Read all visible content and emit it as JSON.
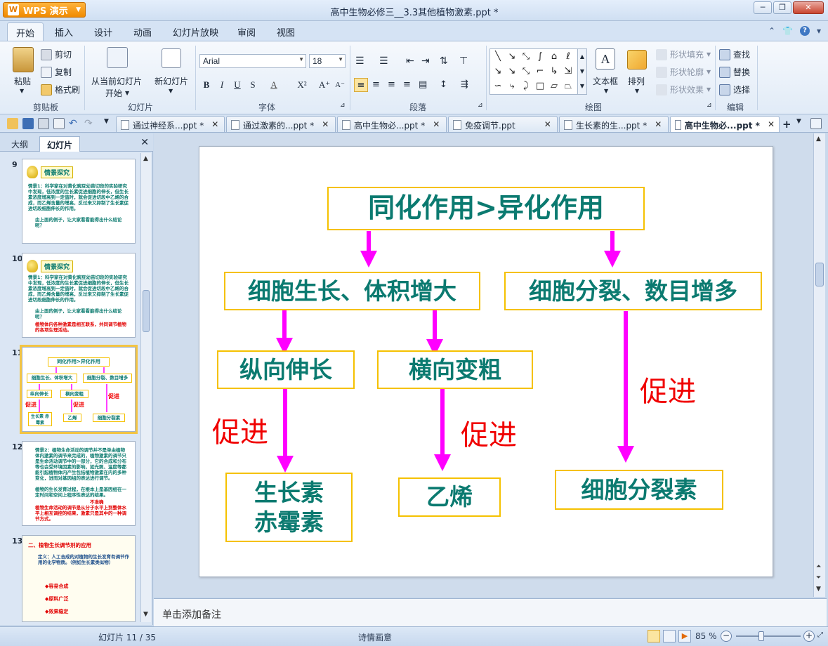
{
  "app": {
    "menu_button": "WPS 演示",
    "window_title": "高中生物必修三__3.3其他植物激素.ppt *"
  },
  "ribbon_tabs": [
    "开始",
    "插入",
    "设计",
    "动画",
    "幻灯片放映",
    "审阅",
    "视图"
  ],
  "ribbon": {
    "clipboard": {
      "paste": "粘贴",
      "cut": "剪切",
      "copy": "复制",
      "format_painter": "格式刷",
      "label": "剪贴板"
    },
    "slides": {
      "from_current": "从当前幻灯片",
      "start": "开始",
      "new_slide": "新幻灯片",
      "label": "幻灯片"
    },
    "font": {
      "family": "Arial",
      "size": "18",
      "label": "字体"
    },
    "paragraph": {
      "label": "段落"
    },
    "drawing": {
      "textbox": "文本框",
      "arrange": "排列",
      "shape_fill": "形状填充",
      "shape_outline": "形状轮廓",
      "shape_effect": "形状效果",
      "label": "绘图"
    },
    "editing": {
      "find": "查找",
      "replace": "替换",
      "select": "选择",
      "label": "编辑"
    }
  },
  "doc_tabs": [
    {
      "label": "通过神经系...ppt *"
    },
    {
      "label": "通过激素的...ppt *"
    },
    {
      "label": "高中生物必...ppt *"
    },
    {
      "label": "免疫调节.ppt"
    },
    {
      "label": "生长素的生...ppt *"
    },
    {
      "label": "高中生物必...ppt *",
      "active": true
    }
  ],
  "left_panel": {
    "tab_outline": "大纲",
    "tab_slides": "幻灯片",
    "thumbnails": [
      {
        "num": "9",
        "heading": "情景探究",
        "text": "情景1：科学家在对黄化豌豆幼苗切段的实验研究中发现，低浓度的生长素促进细胞的伸长，但生长素浓度增高到一定值时，就会促进切段中乙烯的合成，而乙烯含量的增高，反过来又抑制了生长素促进切段细胞伸长的作用。",
        "text2": "由上面的例子，让大家看看能得出什么结论呢？"
      },
      {
        "num": "10",
        "heading": "情景探究",
        "text": "情景1：科学家在对黄化豌豆幼苗切段的实验研究中发现，低浓度的生长素促进细胞的伸长，但生长素浓度增高到一定值时，就会促进切段中乙烯的合成，而乙烯含量的增高，反过来又抑制了生长素促进切段细胞伸长的作用。",
        "text2": "由上面的例子，让大家看看能得出什么结论呢？",
        "red": "植物体内各种激素是相互联系，共同调节植物的各项生理活动。"
      },
      {
        "num": "11"
      },
      {
        "num": "12",
        "text": "情景2：植物生命活动的调节并不是单由植物体内激素的调节来完成的，植物激素的调节只是生命活动调节中的一部分，它的合成和分布等也会受环境因素的影响，如光照、温度等都能引起植物体内产生包括植物激素在内的多种变化，进而对基因组的表达进行调节。",
        "text2": "植物的生长发育过程，在根本上是基因组在一定时间和空间上程序性表达的结果。",
        "red_label": "不准确",
        "red": "植物生命活动的调节是从分子水平上到整体水平上相互调控的结果，激素只是其中的一种调节方式。"
      },
      {
        "num": "13",
        "title": "二、植物生长调节剂的应用",
        "text": "定义：人工合成的对植物的生长发育有调节作用的化学物质。（例如生长素类似物）",
        "bullets": [
          "◆容易合成",
          "◆原料广泛",
          "◆效果稳定"
        ]
      }
    ],
    "mini_slide": {
      "top": "同化作用>异化作用",
      "left": "细胞生长、体积增大",
      "right": "细胞分裂、数目增多",
      "vertical": "纵向伸长",
      "transverse": "横向变粗",
      "auxin": "生长素 赤霉素",
      "ethylene": "乙烯",
      "cytokinin": "细胞分裂素",
      "promote": "促进"
    }
  },
  "slide": {
    "box_top": "同化作用>异化作用",
    "box_growth": "细胞生长、体积增大",
    "box_division": "细胞分裂、数目增多",
    "box_vertical": "纵向伸长",
    "box_transverse": "横向变粗",
    "box_auxin_1": "生长素",
    "box_auxin_2": "赤霉素",
    "box_ethylene": "乙烯",
    "box_cytokinin": "细胞分裂素",
    "promote_1": "促进",
    "promote_2": "促进",
    "promote_3": "促进"
  },
  "notes_placeholder": "单击添加备注",
  "status": {
    "slide_counter": "幻灯片 11 / 35",
    "theme": "诗情画意",
    "zoom": "85 %"
  },
  "colors": {
    "box_border": "#f5c100",
    "box_text": "#0b7a70",
    "arrow": "#ff00ff",
    "promote_text": "#f00000"
  }
}
